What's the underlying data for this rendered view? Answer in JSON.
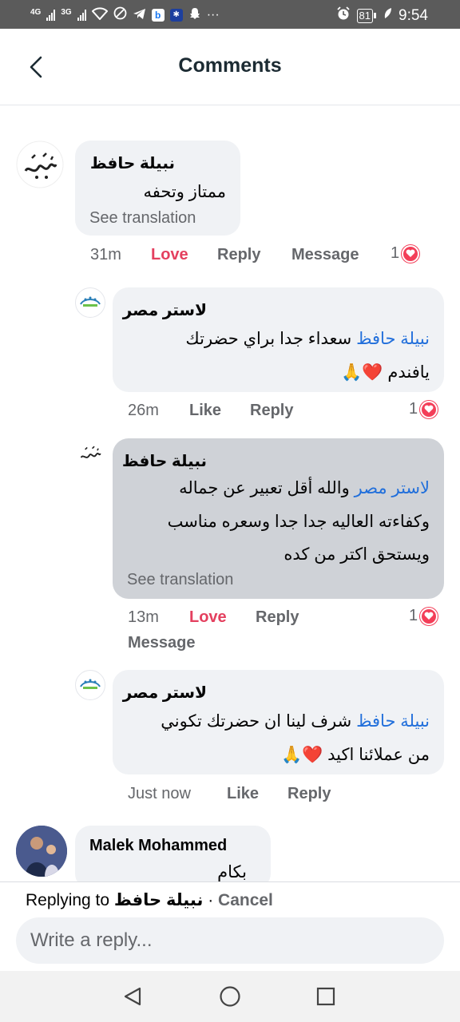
{
  "status_bar": {
    "network_1": "4G",
    "network_2": "3G",
    "battery": "81",
    "time": "9:54"
  },
  "header": {
    "title": "Comments"
  },
  "comments": [
    {
      "author": "نبيلة حافظ",
      "text_lines": [
        "ممتاز وتحفه"
      ],
      "see_translation": "See translation",
      "time": "31m",
      "reaction_label": "Love",
      "reply_label": "Reply",
      "message_label": "Message",
      "reaction_count": "1"
    },
    {
      "author": "لاستر مصر",
      "mention": "نبيلة حافظ",
      "text_line_1": "سعداء جدا براي حضرتك",
      "text_line_2": "يافندم ❤️🙏",
      "time": "26m",
      "like_label": "Like",
      "reply_label": "Reply",
      "reaction_count": "1"
    },
    {
      "author": "نبيلة حافظ",
      "mention": "لاستر مصر",
      "text_line_1": "والله أقل تعبير عن جماله",
      "text_line_2": "وكفاءته العاليه جدا جدا وسعره مناسب",
      "text_line_3": "ويستحق اكتر من كده",
      "see_translation": "See translation",
      "time": "13m",
      "reaction_label": "Love",
      "reply_label": "Reply",
      "message_label": "Message",
      "reaction_count": "1"
    },
    {
      "author": "لاستر مصر",
      "mention": "نبيلة حافظ",
      "text_line_1": "شرف لينا ان حضرتك تكوني",
      "text_line_2": "من عملائنا اكيد ❤️🙏",
      "time": "Just now",
      "like_label": "Like",
      "reply_label": "Reply"
    },
    {
      "author": "Malek Mohammed",
      "text_lines": [
        "بكام"
      ]
    }
  ],
  "composer": {
    "replying_prefix": "Replying to",
    "replying_name": "نبيلة حافظ",
    "separator": "·",
    "cancel_label": "Cancel",
    "placeholder": "Write a reply..."
  },
  "colors": {
    "accent_love": "#e4405f",
    "mention_blue": "#216fdb",
    "bubble_bg": "#f0f2f5",
    "selected_bubble_bg": "#cfd2d7"
  }
}
